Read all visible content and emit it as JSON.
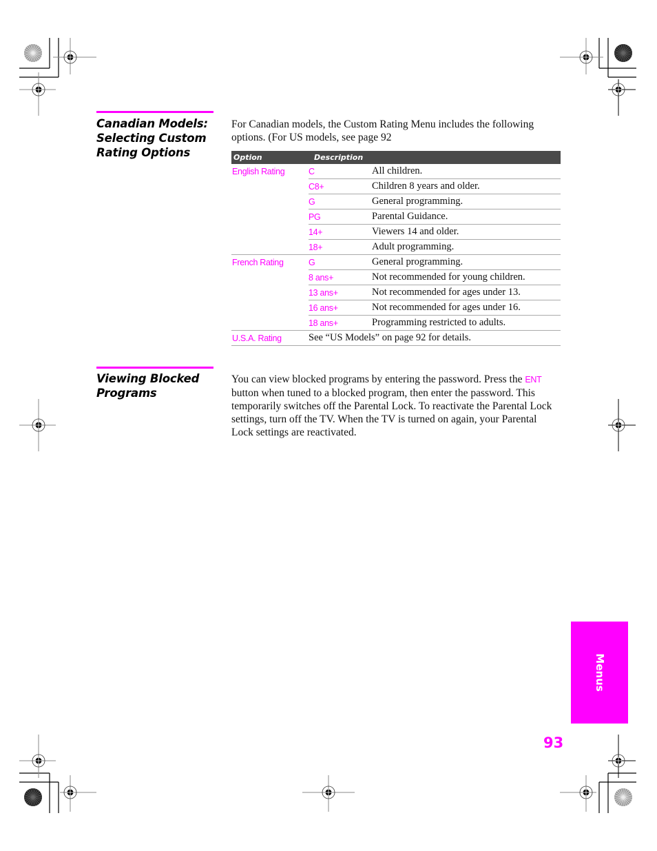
{
  "sections": [
    {
      "heading_lines": [
        "Canadian Models:",
        "Selecting Custom",
        "Rating Options"
      ],
      "intro": "For Canadian models, the Custom Rating Menu includes the following options. (For US models, see page 92",
      "table": {
        "headers": {
          "option": "Option",
          "description": "Description"
        },
        "groups": [
          {
            "option": "English Rating",
            "rows": [
              {
                "code": "C",
                "description": "All children."
              },
              {
                "code": "C8+",
                "description": "Children 8 years and older."
              },
              {
                "code": "G",
                "description": "General programming."
              },
              {
                "code": "PG",
                "description": "Parental Guidance."
              },
              {
                "code": "14+",
                "description": "Viewers 14 and older."
              },
              {
                "code": "18+",
                "description": "Adult programming."
              }
            ]
          },
          {
            "option": "French Rating",
            "rows": [
              {
                "code": "G",
                "description": "General programming."
              },
              {
                "code": "8 ans+",
                "description": "Not recommended for young children."
              },
              {
                "code": "13 ans+",
                "description": "Not recommended for ages under 13."
              },
              {
                "code": "16 ans+",
                "description": "Not recommended for ages under 16."
              },
              {
                "code": "18 ans+",
                "description": "Programming restricted to adults."
              }
            ]
          },
          {
            "option": "U.S.A. Rating",
            "span_text": "See “US Models” on page 92 for details."
          }
        ]
      }
    },
    {
      "heading_lines": [
        "Viewing Blocked",
        "Programs"
      ],
      "body_parts": {
        "pre": "You can view blocked programs by entering the password. Press the ",
        "key": "ENT",
        "post": " button when tuned to a blocked program, then enter the password. This temporarily switches off the Parental Lock. To reactivate the Parental Lock settings, turn off the TV. When the TV is turned on again, your Parental Lock settings are reactivated."
      }
    }
  ],
  "side_tab": {
    "label": "Menus",
    "color": "#ff00ff"
  },
  "page_number": "93",
  "colors": {
    "accent": "#ff00ff",
    "table_header_bg": "#4a4a4a"
  },
  "decorations": [
    "registration-mark-icon",
    "color-wheel-icon",
    "crop-mark-icon"
  ]
}
